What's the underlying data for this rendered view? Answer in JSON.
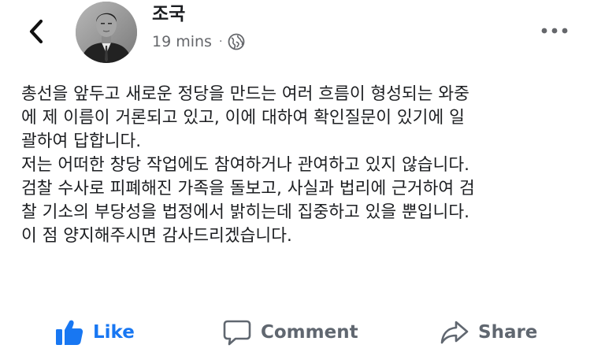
{
  "header": {
    "author_name": "조국",
    "timestamp": "19 mins",
    "separator": "·",
    "privacy_icon": "globe-icon",
    "back_icon": "chevron-left-icon",
    "more_icon": "more-horizontal-icon"
  },
  "post": {
    "lines": [
      "총선을 앞두고 새로운 정당을 만드는 여러 흐름이 형성되는 와중",
      "에 제 이름이 거론되고 있고, 이에 대하여 확인질문이 있기에 일",
      "괄하여 답합니다.",
      "저는 어떠한 창당 작업에도 참여하거나 관여하고 있지 않습니다.",
      "검찰 수사로 피폐해진 가족을 돌보고, 사실과 법리에 근거하여 검",
      "찰 기소의 부당성을 법정에서 밝히는데 집중하고 있을 뿐입니다.",
      "이 점 양지해주시면 감사드리겠습니다."
    ]
  },
  "actions": {
    "like": {
      "label": "Like",
      "icon": "thumbs-up-icon",
      "color": "#1877f2"
    },
    "comment": {
      "label": "Comment",
      "icon": "comment-bubble-icon",
      "color": "#606770"
    },
    "share": {
      "label": "Share",
      "icon": "share-arrow-icon",
      "color": "#606770"
    }
  }
}
